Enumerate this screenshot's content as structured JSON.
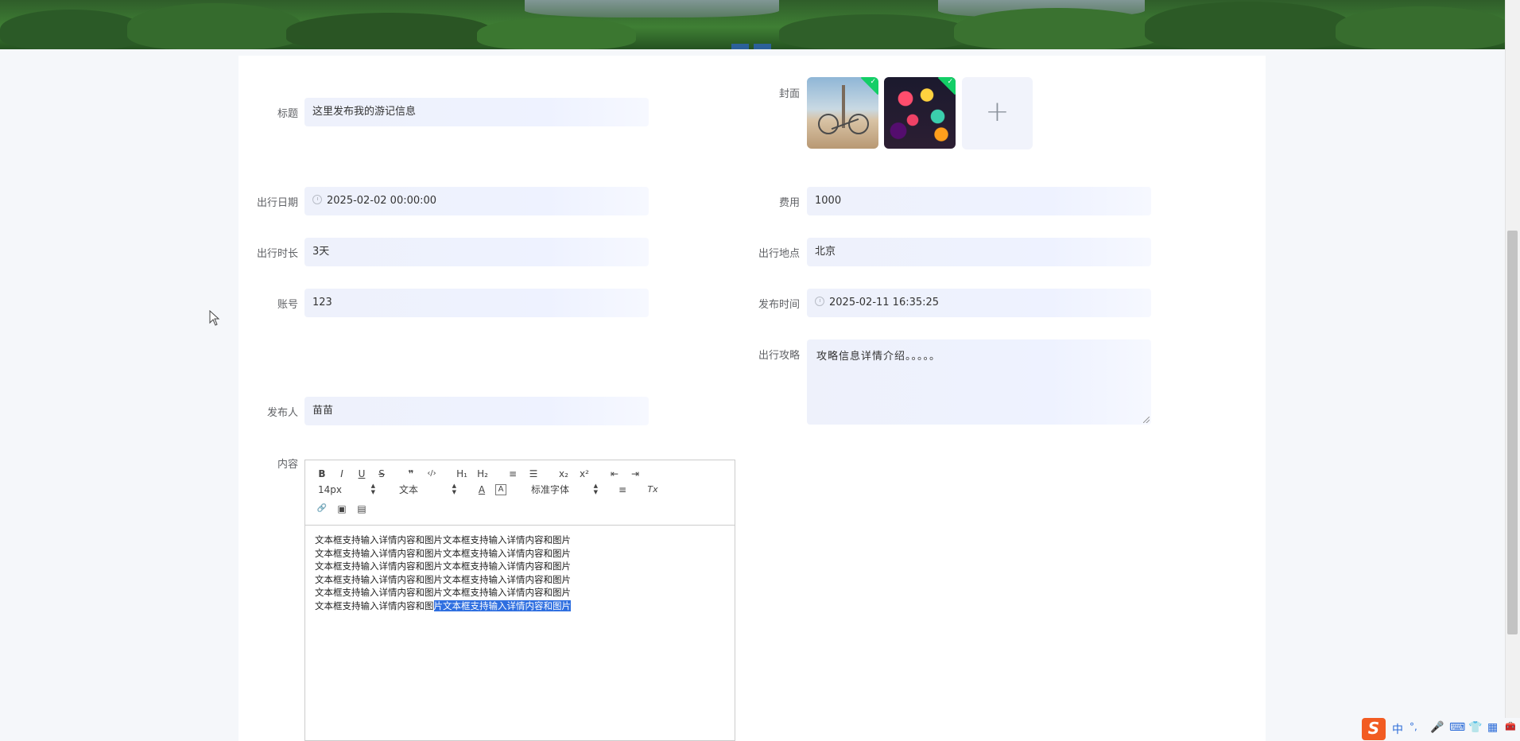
{
  "form": {
    "title": {
      "label": "标题",
      "value": "这里发布我的游记信息"
    },
    "cover": {
      "label": "封面"
    },
    "travel_date": {
      "label": "出行日期",
      "value": "2025-02-02 00:00:00"
    },
    "cost": {
      "label": "费用",
      "value": "1000"
    },
    "duration": {
      "label": "出行时长",
      "value": "3天"
    },
    "location": {
      "label": "出行地点",
      "value": "北京"
    },
    "account": {
      "label": "账号",
      "value": "123"
    },
    "publish_time": {
      "label": "发布时间",
      "value": "2025-02-11 16:35:25"
    },
    "strategy": {
      "label": "出行攻略",
      "value": "攻略信息详情介绍。。。。。"
    },
    "publisher": {
      "label": "发布人",
      "value": "苗苗"
    },
    "content": {
      "label": "内容",
      "toolbar": {
        "bold": "B",
        "italic": "I",
        "underline": "U",
        "strike": "S",
        "blockquote": "❞",
        "code": "‹/›",
        "h1": "H₁",
        "h2": "H₂",
        "ordered_list": "≡",
        "bullet_list": "☰",
        "subscript": "x₂",
        "superscript": "x²",
        "outdent": "⇤",
        "indent": "⇥",
        "size": "14px",
        "header": "文本",
        "color": "A",
        "background": "A",
        "font": "标准字体",
        "align": "≡",
        "clean": "Tx",
        "link": "🔗",
        "image": "▣",
        "video": "▤"
      },
      "lines": [
        "文本框支持输入详情内容和图片文本框支持输入详情内容和图片",
        "文本框支持输入详情内容和图片文本框支持输入详情内容和图片",
        "文本框支持输入详情内容和图片文本框支持输入详情内容和图片",
        "文本框支持输入详情内容和图片文本框支持输入详情内容和图片",
        "文本框支持输入详情内容和图片文本框支持输入详情内容和图片"
      ],
      "last_line_plain": "文本框支持输入详情内容和图",
      "last_line_selected": "片文本框支持输入详情内容和图片"
    }
  },
  "upload": {
    "add_symbol": "+",
    "check_symbol": "✓"
  },
  "ime": {
    "logo": "S",
    "mode": "中",
    "punct": "°,",
    "icons": [
      "mic-icon",
      "keyboard-icon",
      "shirt-icon",
      "grid-icon"
    ]
  },
  "colors": {
    "accent": "#13ce66",
    "field_bg": "#eef1fb",
    "selection": "#2f6fe0"
  }
}
